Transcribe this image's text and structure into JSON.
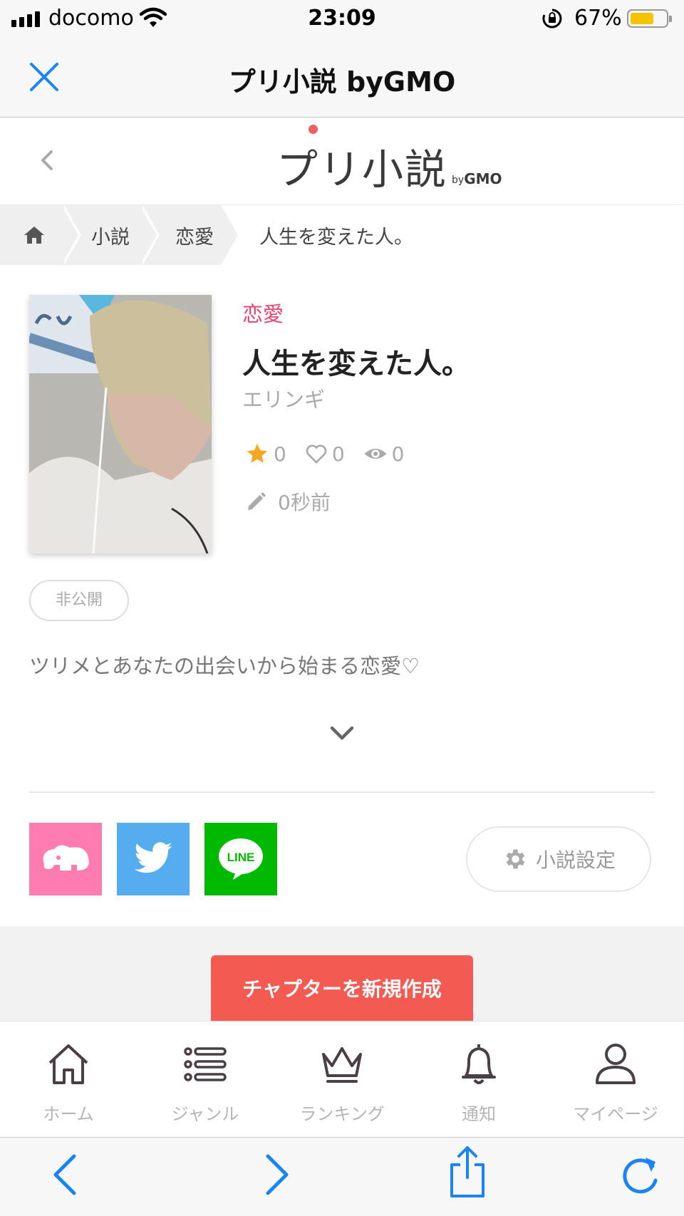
{
  "status_bar": {
    "carrier": "docomo",
    "time": "23:09",
    "battery_percent": "67%",
    "battery_level": 0.67
  },
  "browser": {
    "title": "プリ小説 byGMO"
  },
  "site": {
    "logo_main": "プリ小説",
    "logo_by": "by",
    "logo_gmo": "GMO"
  },
  "breadcrumb": {
    "items": [
      "小説",
      "恋愛",
      "人生を変えた人。"
    ]
  },
  "novel": {
    "genre": "恋愛",
    "title": "人生を変えた人。",
    "author": "エリンギ",
    "stars": "0",
    "likes": "0",
    "views": "0",
    "updated": "0秒前",
    "visibility": "非公開",
    "synopsis": "ツリメとあなたの出会いから始まる恋愛♡"
  },
  "actions": {
    "settings_label": "小説設定",
    "new_chapter_label": "チャプターを新規作成",
    "line_label": "LINE"
  },
  "tabs": [
    {
      "label": "ホーム",
      "icon": "home-icon"
    },
    {
      "label": "ジャンル",
      "icon": "list-icon"
    },
    {
      "label": "ランキング",
      "icon": "crown-icon"
    },
    {
      "label": "通知",
      "icon": "bell-icon"
    },
    {
      "label": "マイページ",
      "icon": "user-icon"
    }
  ],
  "colors": {
    "accent_pink": "#e8436e",
    "primary_button": "#f25a52",
    "ios_blue": "#1a84f5",
    "star": "#f5a623"
  }
}
